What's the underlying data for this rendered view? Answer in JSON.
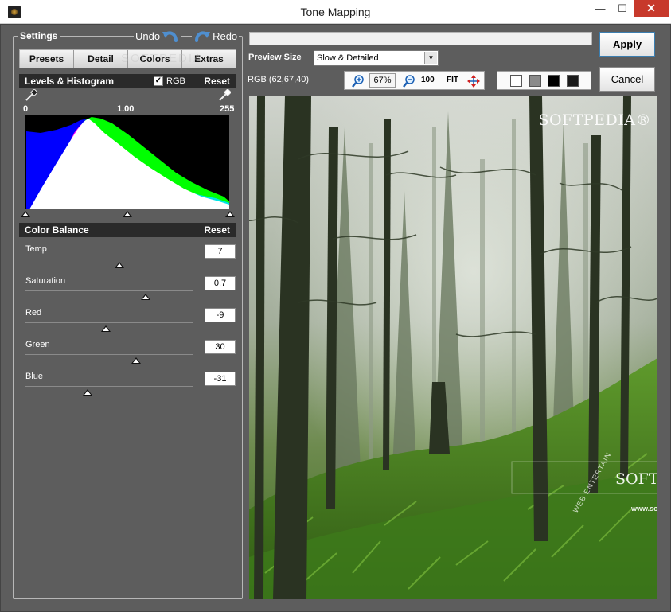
{
  "window": {
    "title": "Tone Mapping",
    "close_glyph": "✕",
    "minimize_glyph": "—",
    "maximize_glyph": "☐"
  },
  "settings": {
    "legend": "Settings",
    "undo_label": "Undo",
    "redo_label": "Redo",
    "tabs": [
      "Presets",
      "Detail",
      "Colors",
      "Extras"
    ],
    "faint_watermark": "SOFTPEDIA",
    "levels": {
      "title": "Levels & Histogram",
      "rgb_checked": true,
      "rgb_label": "RGB",
      "reset_label": "Reset",
      "scale_left": "0",
      "scale_mid": "1.00",
      "scale_right": "255",
      "black_point": 0,
      "gamma": 1.0,
      "white_point": 255
    },
    "color_balance": {
      "title": "Color Balance",
      "reset_label": "Reset",
      "sliders": [
        {
          "label": "Temp",
          "value": "7",
          "position": 0.56
        },
        {
          "label": "Saturation",
          "value": "0.7",
          "position": 0.72
        },
        {
          "label": "Red",
          "value": "-9",
          "position": 0.48
        },
        {
          "label": "Green",
          "value": "30",
          "position": 0.66
        },
        {
          "label": "Blue",
          "value": "-31",
          "position": 0.37
        }
      ]
    }
  },
  "preview": {
    "size_label": "Preview Size",
    "size_value": "Slow & Detailed",
    "rgb_readout": "RGB (62,67,40)",
    "zoom_level": "67%",
    "zoom_100_label": "100",
    "fit_label": "FIT",
    "watermark_top": "SOFTPEDIA®",
    "watermark_mid": "SOFT",
    "watermark_url": "www.soft",
    "watermark_web": "WEB ENTERTAIN"
  },
  "buttons": {
    "apply": "Apply",
    "cancel": "Cancel"
  },
  "colors": {
    "panel_bg": "#5d5d5d",
    "section_bar": "#2a2a2a",
    "close_red": "#c7392b"
  }
}
